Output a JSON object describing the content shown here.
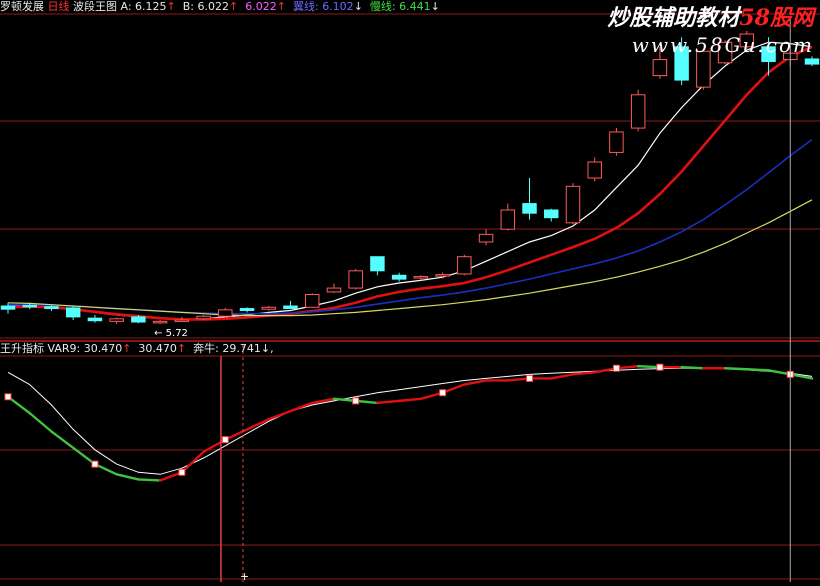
{
  "colors": {
    "background": "#000000",
    "grid": "#8a1a1a",
    "divider": "#b02020",
    "up_candle": "#ff5a5a",
    "down_candle": "#55ffff",
    "ma_white": "#ffffff",
    "ma_red": "#e01010",
    "ma_blue": "#1a2fc0",
    "ma_yellow": "#d8d860",
    "var9_up": "#e01010",
    "var9_down": "#40c040",
    "signal_line": "#ffffff",
    "cursor": "#e04040"
  },
  "header_top": {
    "stock_name": "罗顿发展",
    "period": "日线",
    "indicator": "波段王图",
    "a_label": "A:",
    "a_value": "6.125",
    "a_arrow": "↑",
    "b_label": "B:",
    "b_value": "6.022",
    "b_arrow": "↑",
    "c_value": "6.022",
    "c_arrow": "↑",
    "d_label": "翼线:",
    "d_value": "6.102",
    "d_arrow": "↓",
    "e_label": "慢线:",
    "e_value": "6.441",
    "e_arrow": "↓"
  },
  "header_bottom": {
    "indicator": "王升指标",
    "var9_label": "VAR9:",
    "var9_value_1": "30.470",
    "var9_arrow_1": "↑",
    "var9_value_2": "30.470",
    "var9_arrow_2": "↑",
    "bull_label": "奔牛:",
    "bull_value": "29.741",
    "bull_arrow": "↓",
    "trailing": ","
  },
  "watermark": {
    "line1_text": "炒股辅助教材",
    "line1_red": "58股网",
    "line2": "www.58Gu.com"
  },
  "annotations": {
    "low_price": "← 5.72",
    "cursor_marker": "+"
  },
  "chart_data": [
    {
      "type": "candlestick",
      "title": "罗顿发展 日线 波段王图",
      "ylim": [
        5.5,
        10.5
      ],
      "candles": [
        {
          "o": 6.0,
          "h": 6.05,
          "l": 5.88,
          "c": 5.95
        },
        {
          "o": 6.01,
          "h": 6.05,
          "l": 5.95,
          "c": 5.99
        },
        {
          "o": 5.99,
          "h": 6.02,
          "l": 5.92,
          "c": 5.96
        },
        {
          "o": 5.97,
          "h": 6.0,
          "l": 5.78,
          "c": 5.83
        },
        {
          "o": 5.81,
          "h": 5.86,
          "l": 5.74,
          "c": 5.77
        },
        {
          "o": 5.76,
          "h": 5.82,
          "l": 5.72,
          "c": 5.8
        },
        {
          "o": 5.83,
          "h": 5.86,
          "l": 5.73,
          "c": 5.75
        },
        {
          "o": 5.74,
          "h": 5.78,
          "l": 5.72,
          "c": 5.76
        },
        {
          "o": 5.77,
          "h": 5.83,
          "l": 5.75,
          "c": 5.78
        },
        {
          "o": 5.8,
          "h": 5.86,
          "l": 5.78,
          "c": 5.84
        },
        {
          "o": 5.84,
          "h": 5.97,
          "l": 5.82,
          "c": 5.94
        },
        {
          "o": 5.96,
          "h": 5.98,
          "l": 5.9,
          "c": 5.93
        },
        {
          "o": 5.95,
          "h": 6.0,
          "l": 5.93,
          "c": 5.98
        },
        {
          "o": 6.0,
          "h": 6.08,
          "l": 5.96,
          "c": 5.96
        },
        {
          "o": 5.98,
          "h": 6.2,
          "l": 5.97,
          "c": 6.18
        },
        {
          "o": 6.22,
          "h": 6.35,
          "l": 6.2,
          "c": 6.28
        },
        {
          "o": 6.28,
          "h": 6.58,
          "l": 6.26,
          "c": 6.55
        },
        {
          "o": 6.77,
          "h": 6.77,
          "l": 6.48,
          "c": 6.55
        },
        {
          "o": 6.48,
          "h": 6.52,
          "l": 6.38,
          "c": 6.42
        },
        {
          "o": 6.44,
          "h": 6.48,
          "l": 6.4,
          "c": 6.46
        },
        {
          "o": 6.47,
          "h": 6.52,
          "l": 6.43,
          "c": 6.49
        },
        {
          "o": 6.5,
          "h": 6.8,
          "l": 6.48,
          "c": 6.77
        },
        {
          "o": 7.0,
          "h": 7.2,
          "l": 6.95,
          "c": 7.12
        },
        {
          "o": 7.2,
          "h": 7.6,
          "l": 7.18,
          "c": 7.5
        },
        {
          "o": 7.6,
          "h": 8.0,
          "l": 7.35,
          "c": 7.45
        },
        {
          "o": 7.5,
          "h": 7.52,
          "l": 7.32,
          "c": 7.38
        },
        {
          "o": 7.3,
          "h": 7.92,
          "l": 7.28,
          "c": 7.87
        },
        {
          "o": 8.0,
          "h": 8.32,
          "l": 7.95,
          "c": 8.25
        },
        {
          "o": 8.4,
          "h": 8.78,
          "l": 8.35,
          "c": 8.72
        },
        {
          "o": 8.78,
          "h": 9.38,
          "l": 8.73,
          "c": 9.3
        },
        {
          "o": 9.6,
          "h": 10.05,
          "l": 9.55,
          "c": 9.85
        },
        {
          "o": 10.05,
          "h": 10.2,
          "l": 9.45,
          "c": 9.53
        },
        {
          "o": 9.42,
          "h": 10.02,
          "l": 9.38,
          "c": 9.98
        },
        {
          "o": 9.8,
          "h": 10.15,
          "l": 9.78,
          "c": 10.12
        },
        {
          "o": 10.05,
          "h": 10.3,
          "l": 10.0,
          "c": 10.25
        },
        {
          "o": 10.05,
          "h": 10.2,
          "l": 9.6,
          "c": 9.82
        },
        {
          "o": 9.85,
          "h": 10.0,
          "l": 9.75,
          "c": 9.95
        },
        {
          "o": 9.86,
          "h": 9.9,
          "l": 9.75,
          "c": 9.78
        }
      ],
      "series": [
        {
          "values": [
            6.01,
            6.0,
            5.98,
            5.95,
            5.9,
            5.86,
            5.83,
            5.8,
            5.79,
            5.8,
            5.83,
            5.86,
            5.9,
            5.93,
            6.0,
            6.08,
            6.2,
            6.3,
            6.36,
            6.4,
            6.45,
            6.55,
            6.7,
            6.85,
            7.0,
            7.1,
            7.25,
            7.5,
            7.85,
            8.2,
            8.7,
            9.1,
            9.45,
            9.75,
            10.0,
            10.12,
            10.1,
            10.05
          ],
          "color": "#ffffff"
        },
        {
          "values": [
            5.98,
            5.99,
            5.98,
            5.95,
            5.91,
            5.87,
            5.84,
            5.81,
            5.79,
            5.79,
            5.8,
            5.82,
            5.85,
            5.88,
            5.92,
            5.97,
            6.05,
            6.15,
            6.22,
            6.27,
            6.31,
            6.36,
            6.45,
            6.56,
            6.68,
            6.8,
            6.92,
            7.05,
            7.22,
            7.45,
            7.75,
            8.1,
            8.5,
            8.9,
            9.3,
            9.65,
            9.9,
            10.05
          ],
          "color": "#e01010"
        },
        {
          "values": [
            6.02,
            6.02,
            6.01,
            6.0,
            5.98,
            5.96,
            5.94,
            5.92,
            5.9,
            5.89,
            5.88,
            5.88,
            5.88,
            5.89,
            5.91,
            5.94,
            5.98,
            6.03,
            6.08,
            6.13,
            6.17,
            6.22,
            6.28,
            6.35,
            6.42,
            6.5,
            6.58,
            6.66,
            6.75,
            6.86,
            7.0,
            7.16,
            7.35,
            7.58,
            7.82,
            8.08,
            8.35,
            8.6
          ],
          "color": "#1a2fc0"
        },
        {
          "values": [
            6.05,
            6.04,
            6.02,
            6.0,
            5.98,
            5.96,
            5.94,
            5.92,
            5.9,
            5.88,
            5.86,
            5.85,
            5.85,
            5.85,
            5.86,
            5.88,
            5.9,
            5.93,
            5.96,
            5.99,
            6.02,
            6.06,
            6.1,
            6.15,
            6.2,
            6.26,
            6.32,
            6.38,
            6.45,
            6.53,
            6.62,
            6.72,
            6.84,
            6.98,
            7.14,
            7.3,
            7.48,
            7.66
          ],
          "color": "#d8d860"
        }
      ]
    },
    {
      "type": "line",
      "title": "王升指标",
      "ylim": [
        0,
        100
      ],
      "series": [
        {
          "name": "VAR9",
          "values": [
            80.0,
            72.0,
            63.0,
            55.0,
            47.0,
            42.0,
            39.5,
            39.0,
            43.0,
            53.0,
            59.0,
            64.0,
            69.0,
            73.0,
            77.0,
            79.0,
            78.0,
            77.0,
            78.0,
            79.0,
            82.0,
            86.0,
            88.0,
            88.0,
            89.0,
            89.0,
            91.0,
            92.0,
            94.0,
            95.0,
            94.5,
            94.5,
            94.0,
            94.0,
            93.5,
            93.0,
            91.0,
            89.0
          ],
          "up_color": "#e01010",
          "down_color": "#40c040"
        },
        {
          "name": "奔牛",
          "values": [
            92.0,
            86.0,
            76.0,
            64.0,
            54.0,
            47.0,
            43.0,
            42.0,
            45.0,
            50.0,
            56.0,
            62.0,
            68.0,
            73.0,
            76.0,
            78.0,
            80.0,
            82.0,
            83.5,
            85.0,
            86.5,
            88.0,
            89.0,
            90.0,
            91.0,
            91.5,
            92.0,
            92.5,
            93.0,
            93.5,
            93.8,
            94.0,
            94.0,
            93.8,
            93.2,
            92.5,
            91.5,
            90.0
          ],
          "color": "#ffffff"
        }
      ],
      "markers_at": [
        0,
        4,
        8,
        10,
        16,
        20,
        24,
        28,
        30,
        36
      ]
    }
  ]
}
